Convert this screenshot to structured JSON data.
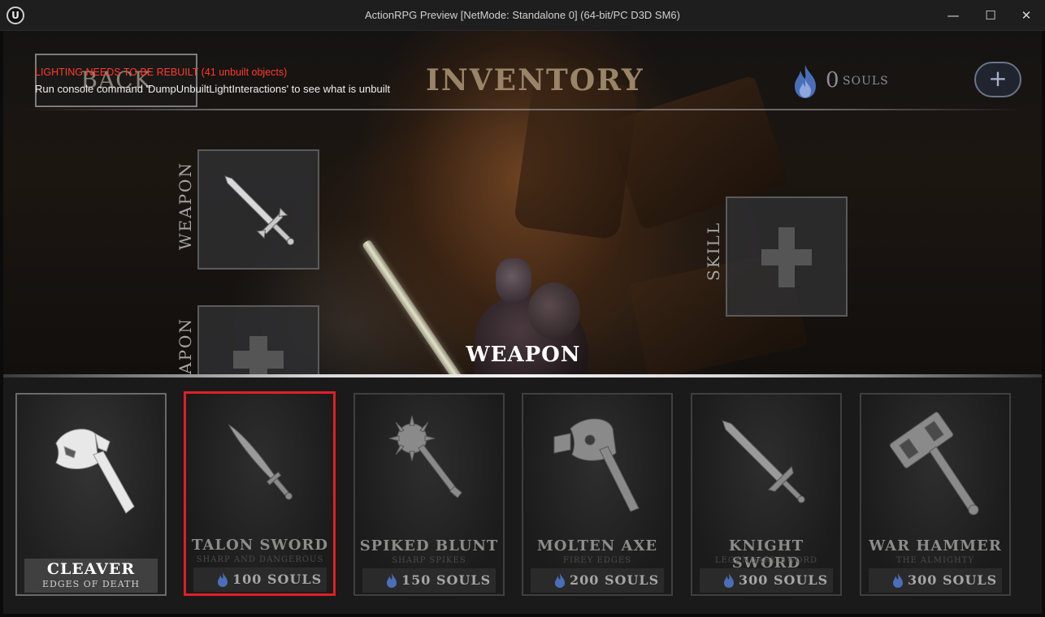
{
  "window": {
    "title": "ActionRPG Preview [NetMode: Standalone 0]  (64-bit/PC D3D SM6)",
    "logo": "U",
    "minimize": "—",
    "maximize": "☐",
    "close": "✕"
  },
  "debug": {
    "lighting_warning": "LIGHTING NEEDS TO BE REBUILT (41 unbuilt objects)",
    "console_hint": "Run console command 'DumpUnbuiltLightInteractions' to see what is unbuilt"
  },
  "header": {
    "back_label": "BACK",
    "title": "INVENTORY",
    "souls_count": "0",
    "souls_label": "SOULS",
    "add_souls_label": "+"
  },
  "equip": {
    "weapon_slot_label": "WEAPON",
    "weapon_slot2_label": "WEAPON",
    "skill_slot_label": "SKILL"
  },
  "store": {
    "section_title": "WEAPON",
    "items": [
      {
        "name": "CLEAVER",
        "desc": "EDGES OF DEATH",
        "price": "",
        "icon": "cleaver-axe-icon",
        "state": "owned"
      },
      {
        "name": "TALON SWORD",
        "desc": "SHARP AND DANGEROUS",
        "price": "100 SOULS",
        "icon": "talon-sword-icon",
        "state": "selected"
      },
      {
        "name": "SPIKED BLUNT",
        "desc": "SHARP SPIKES",
        "price": "150 SOULS",
        "icon": "spiked-mace-icon",
        "state": "locked"
      },
      {
        "name": "MOLTEN AXE",
        "desc": "FIREY EDGES",
        "price": "200 SOULS",
        "icon": "molten-axe-icon",
        "state": "locked"
      },
      {
        "name": "KNIGHT SWORD",
        "desc": "LEGENDARY SWORD",
        "price": "300 SOULS",
        "icon": "knight-sword-icon",
        "state": "locked"
      },
      {
        "name": "WAR HAMMER",
        "desc": "THE ALMIGHTY",
        "price": "300 SOULS",
        "icon": "war-hammer-icon",
        "state": "locked"
      }
    ]
  },
  "colors": {
    "selection": "#e01f26",
    "souls_flame": "#4a6fb8",
    "title_gold": "#9a8468"
  }
}
